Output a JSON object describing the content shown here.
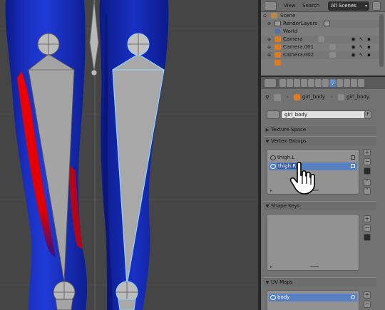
{
  "outliner": {
    "view_label": "View",
    "search_label": "Search",
    "display_mode": "All Scenes",
    "tree": [
      {
        "label": "Scene",
        "icon": "scene-icon"
      },
      {
        "label": "RenderLayers",
        "icon": "renderlayers-icon"
      },
      {
        "label": "World",
        "icon": "world-icon"
      },
      {
        "label": "Camera",
        "icon": "camera-object-icon"
      },
      {
        "label": "Camera.001",
        "icon": "camera-object-icon"
      },
      {
        "label": "Camera.002",
        "icon": "camera-object-icon"
      }
    ]
  },
  "properties": {
    "breadcrumb_object": "girl_body",
    "breadcrumb_mesh": "girl_body",
    "mesh_name": "girl_body",
    "fake_user_label": "F",
    "panels": {
      "texture_space": "Texture Space",
      "vertex_groups": "Vertex Groups",
      "shape_keys": "Shape Keys",
      "uv_maps": "UV Maps"
    },
    "vertex_groups": [
      {
        "name": "thigh.L",
        "selected": false
      },
      {
        "name": "thigh.R",
        "selected": true
      }
    ],
    "uv_maps": [
      {
        "name": "body",
        "selected": true
      }
    ]
  },
  "colors": {
    "selection_blue": "#5680c2",
    "weight_red": "#e60000",
    "mesh_blue": "#0a1a8c",
    "bone_gray": "#a4a4a4"
  }
}
